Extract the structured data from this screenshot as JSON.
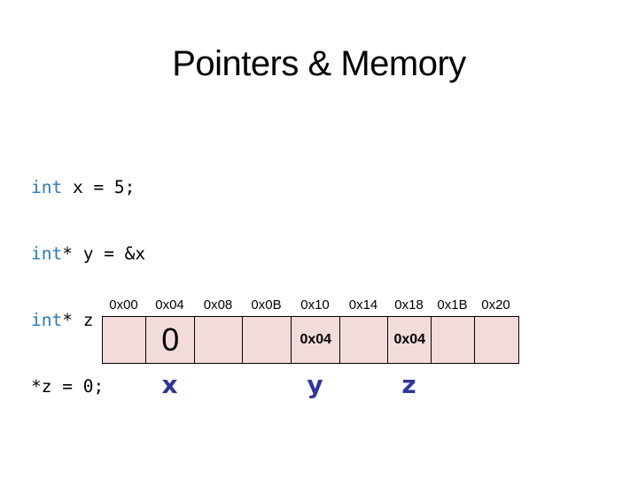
{
  "title": "Pointers & Memory",
  "code": {
    "lines": [
      {
        "kw": "int",
        "rest": " x = 5;"
      },
      {
        "kw": "int",
        "rest": "* y = &x"
      },
      {
        "kw": "int",
        "rest": "* z = y;"
      },
      {
        "kw": "",
        "rest": "*z = 0;"
      }
    ]
  },
  "memory": {
    "addresses": [
      "0x00",
      "0x04",
      "0x08",
      "0x0B",
      "0x10",
      "0x14",
      "0x18",
      "0x1B",
      "0x20"
    ],
    "cells": [
      {
        "value": ""
      },
      {
        "value": "0",
        "size": "big"
      },
      {
        "value": ""
      },
      {
        "value": ""
      },
      {
        "value": "0x04",
        "size": "small"
      },
      {
        "value": ""
      },
      {
        "value": "0x04",
        "size": "small"
      },
      {
        "value": ""
      },
      {
        "value": ""
      }
    ],
    "variables": [
      {
        "name": "x",
        "cell": 1
      },
      {
        "name": "y",
        "cell": 4
      },
      {
        "name": "z",
        "cell": 6
      }
    ]
  },
  "colors": {
    "keyword": "#2b79b8",
    "cell_fill": "#f2dcdb",
    "variable_label": "#2f3699"
  }
}
